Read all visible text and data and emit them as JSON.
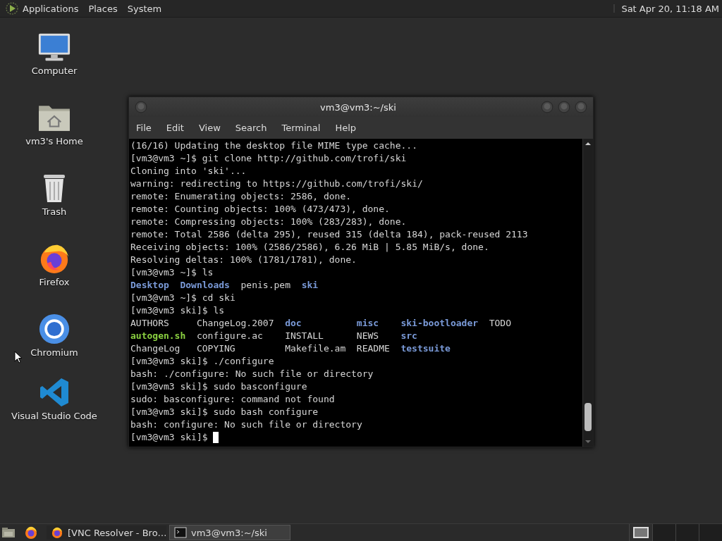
{
  "top_panel": {
    "menus": [
      "Applications",
      "Places",
      "System"
    ],
    "clock": "Sat Apr 20, 11:18 AM"
  },
  "desktop_icons": [
    {
      "kind": "computer",
      "label": "Computer"
    },
    {
      "kind": "home",
      "label": "vm3's Home"
    },
    {
      "kind": "trash",
      "label": "Trash"
    },
    {
      "kind": "firefox",
      "label": "Firefox"
    },
    {
      "kind": "chromium",
      "label": "Chromium"
    },
    {
      "kind": "vscode",
      "label": "Visual Studio Code"
    }
  ],
  "terminal": {
    "title": "vm3@vm3:~/ski",
    "menus": [
      "File",
      "Edit",
      "View",
      "Search",
      "Terminal",
      "Help"
    ],
    "lines": [
      {
        "kind": "text",
        "text": "(16/16) Updating the desktop file MIME type cache..."
      },
      {
        "kind": "text",
        "text": "[vm3@vm3 ~]$ git clone http://github.com/trofi/ski"
      },
      {
        "kind": "text",
        "text": "Cloning into 'ski'..."
      },
      {
        "kind": "text",
        "text": "warning: redirecting to https://github.com/trofi/ski/"
      },
      {
        "kind": "text",
        "text": "remote: Enumerating objects: 2586, done."
      },
      {
        "kind": "text",
        "text": "remote: Counting objects: 100% (473/473), done."
      },
      {
        "kind": "text",
        "text": "remote: Compressing objects: 100% (283/283), done."
      },
      {
        "kind": "text",
        "text": "remote: Total 2586 (delta 295), reused 315 (delta 184), pack-reused 2113"
      },
      {
        "kind": "text",
        "text": "Receiving objects: 100% (2586/2586), 6.26 MiB | 5.85 MiB/s, done."
      },
      {
        "kind": "text",
        "text": "Resolving deltas: 100% (1781/1781), done."
      },
      {
        "kind": "text",
        "text": "[vm3@vm3 ~]$ ls"
      },
      {
        "kind": "list",
        "items": [
          {
            "kind": "directory",
            "text": "Desktop"
          },
          {
            "kind": "directory",
            "text": "Downloads"
          },
          {
            "kind": "file",
            "text": "penis.pem"
          },
          {
            "kind": "directory",
            "text": "ski"
          }
        ]
      },
      {
        "kind": "text",
        "text": "[vm3@vm3 ~]$ cd ski"
      },
      {
        "kind": "text",
        "text": "[vm3@vm3 ski]$ ls"
      },
      {
        "kind": "columns",
        "items": [
          {
            "kind": "file",
            "text": "AUTHORS"
          },
          {
            "kind": "file",
            "text": "ChangeLog.2007"
          },
          {
            "kind": "directory",
            "text": "doc"
          },
          {
            "kind": "directory",
            "text": "misc"
          },
          {
            "kind": "directory",
            "text": "ski-bootloader"
          },
          {
            "kind": "file",
            "text": "TODO"
          }
        ]
      },
      {
        "kind": "columns",
        "items": [
          {
            "kind": "executable",
            "text": "autogen.sh"
          },
          {
            "kind": "file",
            "text": "configure.ac"
          },
          {
            "kind": "file",
            "text": "INSTALL"
          },
          {
            "kind": "file",
            "text": "NEWS"
          },
          {
            "kind": "directory",
            "text": "src"
          }
        ]
      },
      {
        "kind": "columns",
        "items": [
          {
            "kind": "file",
            "text": "ChangeLog"
          },
          {
            "kind": "file",
            "text": "COPYING"
          },
          {
            "kind": "file",
            "text": "Makefile.am"
          },
          {
            "kind": "file",
            "text": "README"
          },
          {
            "kind": "directory",
            "text": "testsuite"
          }
        ]
      },
      {
        "kind": "text",
        "text": "[vm3@vm3 ski]$ ./configure"
      },
      {
        "kind": "text",
        "text": "bash: ./configure: No such file or directory"
      },
      {
        "kind": "text",
        "text": "[vm3@vm3 ski]$ sudo basconfigure"
      },
      {
        "kind": "text",
        "text": "sudo: basconfigure: command not found"
      },
      {
        "kind": "text",
        "text": "[vm3@vm3 ski]$ sudo bash configure"
      },
      {
        "kind": "text",
        "text": "bash: configure: No such file or directory"
      },
      {
        "kind": "prompt",
        "text": "[vm3@vm3 ski]$"
      }
    ]
  },
  "taskbar": {
    "tasks": [
      {
        "kind": "browser",
        "label": "[VNC Resolver - Bro…",
        "selected": false
      },
      {
        "kind": "terminal",
        "label": "vm3@vm3:~/ski",
        "selected": true
      }
    ],
    "workspaces": [
      {
        "selected": true
      },
      {
        "selected": false
      },
      {
        "selected": false
      },
      {
        "selected": false
      }
    ]
  }
}
